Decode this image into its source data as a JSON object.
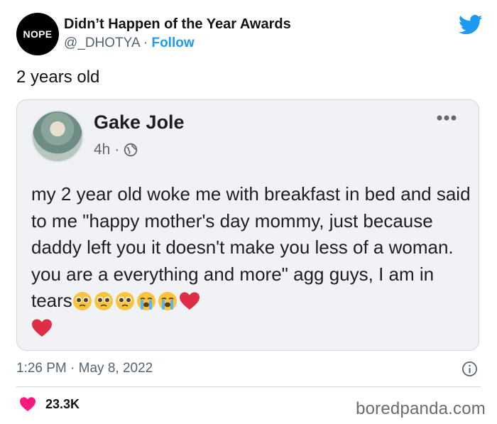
{
  "header": {
    "avatar_text": "NOPE",
    "name": "Didn’t Happen of the Year Awards",
    "handle": "@_DHOTYA",
    "separator": "·",
    "follow_label": "Follow",
    "brand_icon": "twitter-bird-icon",
    "brand_color": "#1d9bf0"
  },
  "tweet": {
    "text": "2 years old",
    "timestamp": "1:26 PM · May 8, 2022",
    "likes": "23.3K"
  },
  "post": {
    "author": "Gake Jole",
    "time": "4h ·",
    "body_text": "my 2 year old woke me with breakfast in bed and said to me \"happy mother's day mommy, just because daddy left you it doesn't make you less of a woman. you are a everything and more\" agg guys, I am in tears",
    "emojis": [
      "pleading-face",
      "pleading-face",
      "pleading-face",
      "crying-face",
      "crying-face",
      "red-heart",
      "red-heart"
    ]
  },
  "footer": {
    "watermark": "boredpanda.com"
  },
  "colors": {
    "accent": "#1d9bf0",
    "like": "#f91880",
    "card_bg": "#f0f2f5"
  }
}
